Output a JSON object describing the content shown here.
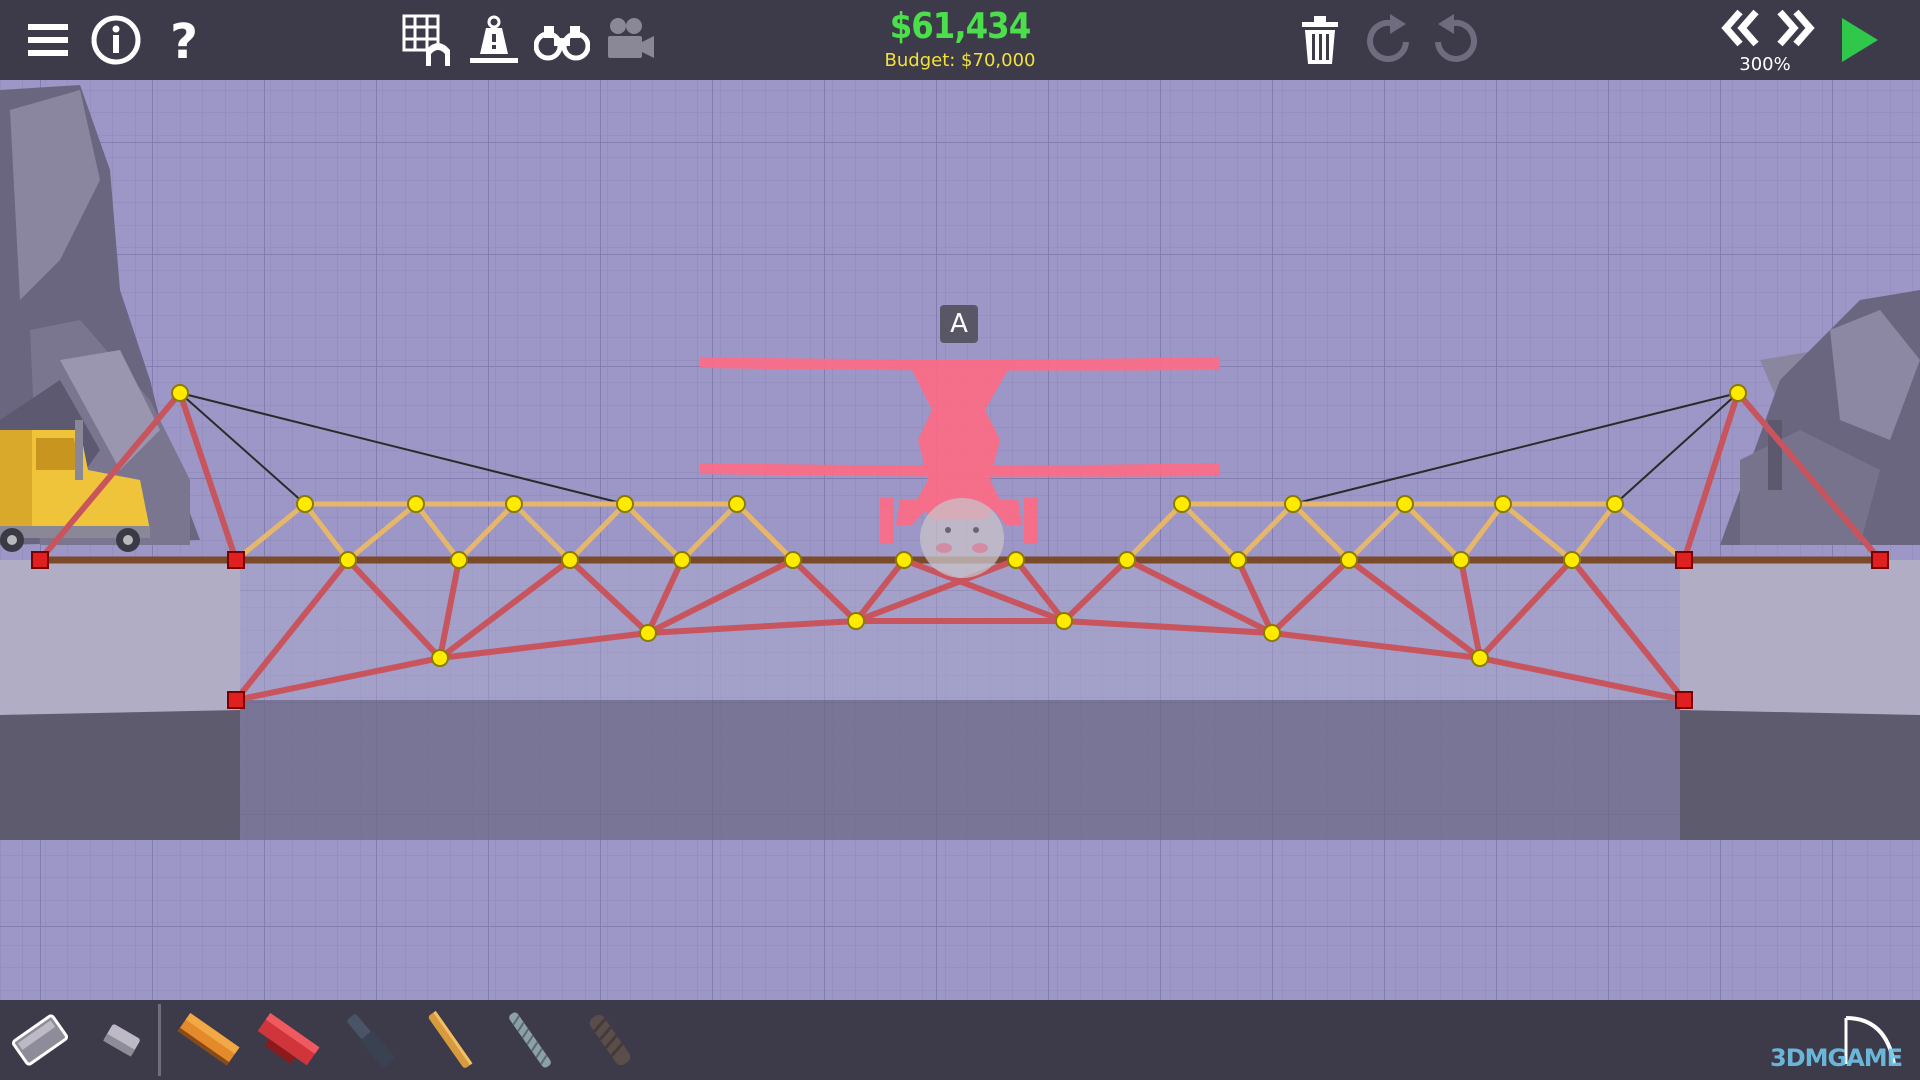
{
  "top_bar": {
    "money": "$61,434",
    "budget": "Budget: $70,000",
    "speed": "300%",
    "left_icons": [
      "menu-icon",
      "info-icon",
      "help-icon"
    ],
    "center_icons": [
      "grid-anchor-icon",
      "weight-icon",
      "binoculars-icon",
      "camera-icon"
    ],
    "right_icons": [
      "trash-icon",
      "redo-icon",
      "undo-icon"
    ],
    "playback_icons": [
      "rewind-icon",
      "fast-forward-icon",
      "play-icon"
    ]
  },
  "scene": {
    "checkpoint_label": "A",
    "vehicle_icon": "airplane-silhouette",
    "truck_icon": "yellow-truck",
    "colors": {
      "background": "#9c97c6",
      "steel": "#c8555d",
      "wood": "#e6b76a",
      "road": "#7a4a2a",
      "rope": "#2a2a2a",
      "joint": "#ffea00",
      "anchor": "#e02020",
      "airplane": "#ff6b85"
    }
  },
  "bottom_bar": {
    "tools": [
      "select-tool-icon",
      "eraser-tool-icon",
      "road-material-icon",
      "reinforced-road-icon",
      "hydraulic-icon",
      "wood-icon",
      "rope-icon",
      "spring-icon"
    ],
    "watermark": "3DMGAME"
  }
}
